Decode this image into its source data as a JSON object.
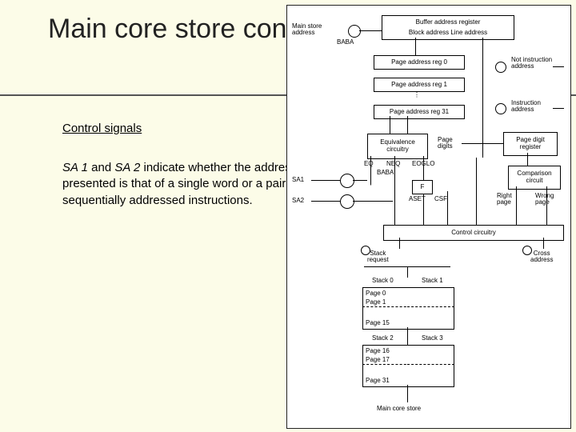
{
  "slide": {
    "title": "Main core store control",
    "subhead": "Control signals",
    "body_pre": "SA 1",
    "body_mid": " and ",
    "body_em2": "SA 2",
    "body_post": " indicate whether the address presented is that of a single word or a pair of sequentially addressed instructions."
  },
  "figure": {
    "labels": {
      "main_store_address": "Main store\naddress",
      "baba_top": "BABA",
      "buffer_addr_reg": "Buffer  address  register",
      "block_line": "Block address    Line address",
      "page_reg0": "Page address  reg 0",
      "page_reg1": "Page address  reg 1",
      "page_reg31": "Page address  reg 31",
      "not_instr": "Not instruction\naddress",
      "instr_addr": "Instruction\naddress",
      "equiv": "Equivalence\ncircuitry",
      "page_digits": "Page\ndigits",
      "page_digit_reg": "Page digit\nregister",
      "eq": "EQ",
      "neq": "NEQ",
      "eoglo": "EOGLO",
      "sa1": "SA1",
      "sa2": "SA2",
      "baba_mid": "BABA",
      "f": "F",
      "aset": "ASET",
      "csf": "CSF",
      "comp": "Comparison\ncircuit",
      "right_page": "Right\npage",
      "wrong_page": "Wrong\npage",
      "control_circ": "Control   circuitry",
      "stack_req": "Stack\nrequest",
      "cross_addr": "Cross\naddress",
      "stack0": "Stack 0",
      "stack1": "Stack 1",
      "stack2": "Stack 2",
      "stack3": "Stack 3",
      "page0": "Page  0",
      "page1": "Page  1",
      "page15": "Page  15",
      "page16": "Page  16",
      "page17": "Page  17",
      "page31": "Page  31",
      "main_core": "Main   core   store"
    }
  }
}
